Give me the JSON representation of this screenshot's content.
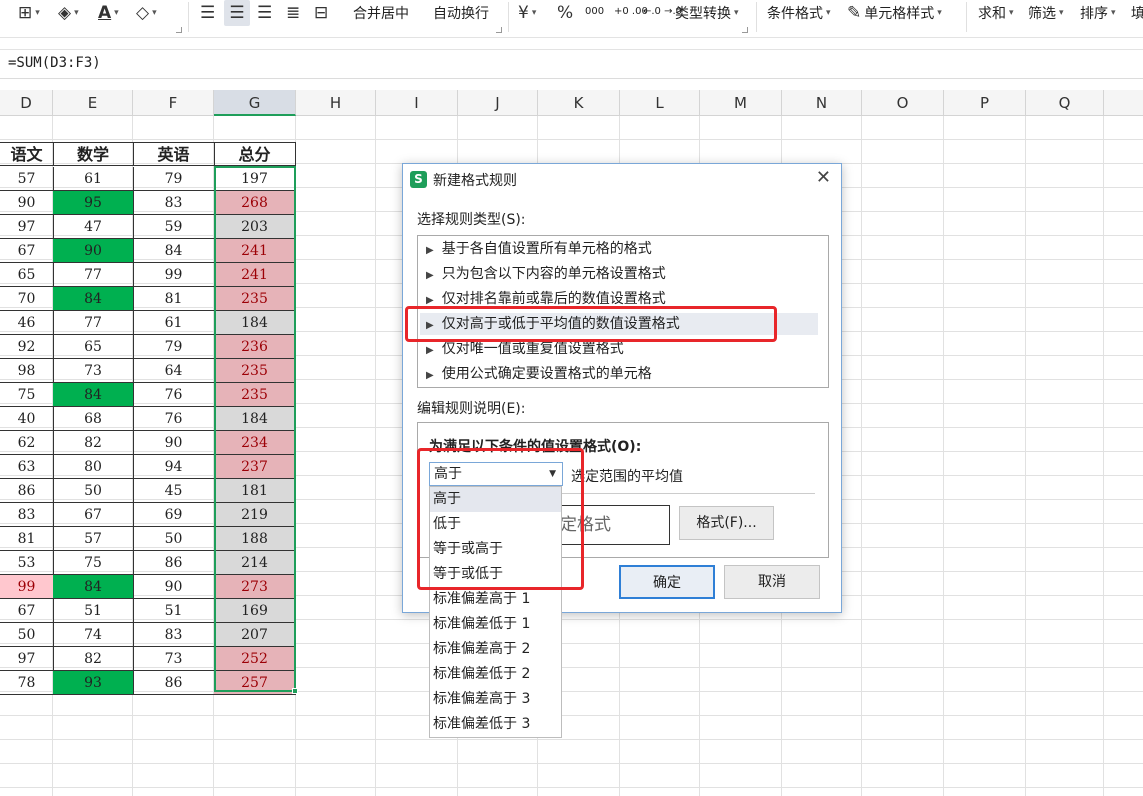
{
  "ribbon": {
    "merge_center": "合并居中",
    "wrap_text": "自动换行",
    "currency_symbol": "¥",
    "percent_symbol": "%",
    "thousands_symbol": "000",
    "inc_decimal": "+0 .00",
    "dec_decimal": "←.0 →.0",
    "type_convert": "类型转换",
    "cond_format": "条件格式",
    "cell_style": "单元格样式",
    "sum": "求和",
    "filter": "筛选",
    "sort": "排序",
    "fill": "填"
  },
  "formula_bar": {
    "text": "=SUM(D3:F3)"
  },
  "columns": [
    "D",
    "E",
    "F",
    "G",
    "H",
    "I",
    "J",
    "K",
    "L",
    "M",
    "N",
    "O",
    "P",
    "Q"
  ],
  "table": {
    "headers": [
      "语文",
      "数学",
      "英语",
      "总分"
    ],
    "rows": [
      [
        "57",
        "61",
        "79",
        "197"
      ],
      [
        "90",
        "95",
        "83",
        "268"
      ],
      [
        "97",
        "47",
        "59",
        "203"
      ],
      [
        "67",
        "90",
        "84",
        "241"
      ],
      [
        "65",
        "77",
        "99",
        "241"
      ],
      [
        "70",
        "84",
        "81",
        "235"
      ],
      [
        "46",
        "77",
        "61",
        "184"
      ],
      [
        "92",
        "65",
        "79",
        "236"
      ],
      [
        "98",
        "73",
        "64",
        "235"
      ],
      [
        "75",
        "84",
        "76",
        "235"
      ],
      [
        "40",
        "68",
        "76",
        "184"
      ],
      [
        "62",
        "82",
        "90",
        "234"
      ],
      [
        "63",
        "80",
        "94",
        "237"
      ],
      [
        "86",
        "50",
        "45",
        "181"
      ],
      [
        "83",
        "67",
        "69",
        "219"
      ],
      [
        "81",
        "57",
        "50",
        "188"
      ],
      [
        "53",
        "75",
        "86",
        "214"
      ],
      [
        "99",
        "84",
        "90",
        "273"
      ],
      [
        "67",
        "51",
        "51",
        "169"
      ],
      [
        "50",
        "74",
        "83",
        "207"
      ],
      [
        "97",
        "82",
        "73",
        "252"
      ],
      [
        "78",
        "93",
        "86",
        "257"
      ]
    ],
    "styles": {
      "D": [
        "",
        "",
        "",
        "",
        "",
        "",
        "",
        "",
        "",
        "",
        "",
        "",
        "",
        "",
        "",
        "",
        "",
        "lpink",
        "",
        "",
        "",
        ""
      ],
      "E": [
        "",
        "green",
        "",
        "green",
        "",
        "green",
        "",
        "",
        "",
        "green",
        "",
        "",
        "",
        "",
        "",
        "",
        "",
        "green",
        "",
        "",
        "",
        "green"
      ],
      "G": [
        "",
        "pink",
        "gray",
        "pink",
        "pink",
        "pink",
        "gray",
        "pink",
        "pink",
        "pink",
        "gray",
        "pink",
        "pink",
        "gray",
        "gray",
        "gray",
        "gray",
        "pink",
        "gray",
        "gray",
        "pink",
        "pink"
      ]
    }
  },
  "colors": {
    "green": "#00b050",
    "pink": "#e6b3b8",
    "gray": "#d9d9d9",
    "select": "#1e9e5a",
    "highlight_red": "#e8262a"
  },
  "dialog": {
    "logo": "S",
    "title": "新建格式规则",
    "close": "✕",
    "select_rule_type_label": "选择规则类型(S):",
    "rule_types": [
      "基于各自值设置所有单元格的格式",
      "只为包含以下内容的单元格设置格式",
      "仅对排名靠前或靠后的数值设置格式",
      "仅对高于或低于平均值的数值设置格式",
      "仅对唯一值或重复值设置格式",
      "使用公式确定要设置格式的单元格"
    ],
    "selected_rule_index": 3,
    "edit_rule_label": "编辑规则说明(E):",
    "condition_label": "为满足以下条件的值设置格式(O):",
    "combo_value": "高于",
    "combo_suffix": "选定范围的平均值",
    "preview_text": "定格式",
    "format_button": "格式(F)...",
    "ok_button": "确定",
    "cancel_button": "取消"
  },
  "dropdown": {
    "options": [
      "高于",
      "低于",
      "等于或高于",
      "等于或低于",
      "标准偏差高于 1",
      "标准偏差低于 1",
      "标准偏差高于 2",
      "标准偏差低于 2",
      "标准偏差高于 3",
      "标准偏差低于 3"
    ],
    "highlighted_index": 0
  }
}
